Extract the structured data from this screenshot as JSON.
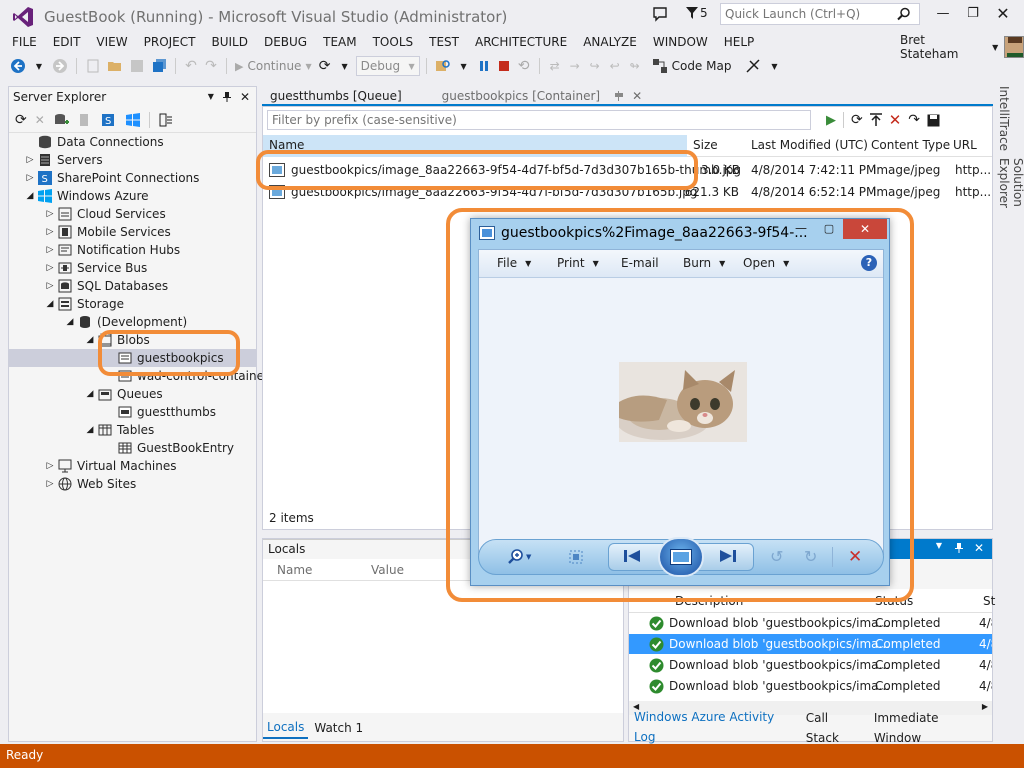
{
  "window": {
    "title": "GuestBook (Running) - Microsoft Visual Studio (Administrator)",
    "notifications_count": "5",
    "quick_launch_placeholder": "Quick Launch (Ctrl+Q)",
    "user_name": "Bret Stateham"
  },
  "menu": [
    "FILE",
    "EDIT",
    "VIEW",
    "PROJECT",
    "BUILD",
    "DEBUG",
    "TEAM",
    "TOOLS",
    "TEST",
    "ARCHITECTURE",
    "ANALYZE",
    "WINDOW",
    "HELP"
  ],
  "toolbar": {
    "continue_label": "Continue",
    "config_value": "Debug",
    "code_map_label": "Code Map"
  },
  "server_explorer": {
    "title": "Server Explorer",
    "tree": [
      {
        "label": "Data Connections",
        "icon": "database-icon",
        "depth": 0,
        "exp": ""
      },
      {
        "label": "Servers",
        "icon": "server-icon",
        "depth": 0,
        "exp": "collapsed"
      },
      {
        "label": "SharePoint Connections",
        "icon": "sharepoint-icon",
        "depth": 0,
        "exp": "collapsed"
      },
      {
        "label": "Windows Azure",
        "icon": "windows-icon",
        "depth": 0,
        "exp": "expanded"
      },
      {
        "label": "Cloud Services",
        "icon": "cloud-icon",
        "depth": 1,
        "exp": "collapsed"
      },
      {
        "label": "Mobile Services",
        "icon": "mobile-icon",
        "depth": 1,
        "exp": "collapsed"
      },
      {
        "label": "Notification Hubs",
        "icon": "hub-icon",
        "depth": 1,
        "exp": "collapsed"
      },
      {
        "label": "Service Bus",
        "icon": "bus-icon",
        "depth": 1,
        "exp": "collapsed"
      },
      {
        "label": "SQL Databases",
        "icon": "sql-icon",
        "depth": 1,
        "exp": "collapsed"
      },
      {
        "label": "Storage",
        "icon": "storage-icon",
        "depth": 1,
        "exp": "expanded"
      },
      {
        "label": "(Development)",
        "icon": "storage-account-icon",
        "depth": 2,
        "exp": "expanded"
      },
      {
        "label": "Blobs",
        "icon": "blob-folder-icon",
        "depth": 3,
        "exp": "expanded"
      },
      {
        "label": "guestbookpics",
        "icon": "container-icon",
        "depth": 4,
        "exp": "",
        "selected": true
      },
      {
        "label": "wad-control-container",
        "icon": "container-icon",
        "depth": 4,
        "exp": ""
      },
      {
        "label": "Queues",
        "icon": "queue-folder-icon",
        "depth": 3,
        "exp": "expanded"
      },
      {
        "label": "guestthumbs",
        "icon": "queue-icon",
        "depth": 4,
        "exp": ""
      },
      {
        "label": "Tables",
        "icon": "table-folder-icon",
        "depth": 3,
        "exp": "expanded"
      },
      {
        "label": "GuestBookEntry",
        "icon": "table-icon",
        "depth": 4,
        "exp": ""
      },
      {
        "label": "Virtual Machines",
        "icon": "vm-icon",
        "depth": 1,
        "exp": "collapsed"
      },
      {
        "label": "Web Sites",
        "icon": "globe-icon",
        "depth": 1,
        "exp": "collapsed"
      }
    ]
  },
  "doc_tabs": {
    "queue_tab": "guestthumbs [Queue]",
    "container_tab": "guestbookpics [Container]"
  },
  "blob_view": {
    "filter_placeholder": "Filter by prefix (case-sensitive)",
    "columns": [
      "Name",
      "Size",
      "Last Modified (UTC)",
      "Content Type",
      "URL"
    ],
    "rows": [
      {
        "name": "guestbookpics/image_8aa22663-9f54-4d7f-bf5d-7d3d307b165b-thumb.jpg",
        "size": "3.0 KB",
        "modified": "4/8/2014 7:42:11 PM",
        "type": "image/jpeg",
        "url": "http..."
      },
      {
        "name": "guestbookpics/image_8aa22663-9f54-4d7f-bf5d-7d3d307b165b.jpg",
        "size": "621.3 KB",
        "modified": "4/8/2014 6:52:14 PM",
        "type": "image/jpeg",
        "url": "http..."
      }
    ],
    "count": "2 items"
  },
  "locals": {
    "title": "Locals",
    "columns": [
      "Name",
      "Value"
    ]
  },
  "bottom_tabs_left": [
    "Locals",
    "Watch 1"
  ],
  "activity_log": {
    "columns": [
      "Description",
      "Status",
      "St"
    ],
    "rows": [
      {
        "desc": "Download blob 'guestbookpics/ima...",
        "status": "Completed",
        "st": "4/8"
      },
      {
        "desc": "Download blob 'guestbookpics/ima...",
        "status": "Completed",
        "st": "4/8"
      },
      {
        "desc": "Download blob 'guestbookpics/ima...",
        "status": "Completed",
        "st": "4/8"
      },
      {
        "desc": "Download blob 'guestbookpics/ima...",
        "status": "Completed",
        "st": "4/8"
      }
    ]
  },
  "bottom_tabs_right": [
    "Windows Azure Activity Log",
    "Call Stack",
    "Immediate Window"
  ],
  "side_tabs": [
    "IntelliTrace",
    "Solution Explorer"
  ],
  "viewer": {
    "title": "guestbookpics%2Fimage_8aa22663-9f54-...",
    "menu": [
      "File",
      "Print",
      "E-mail",
      "Burn",
      "Open"
    ]
  },
  "status": {
    "text": "Ready"
  },
  "colors": {
    "accent": "#007acc",
    "status_bar": "#ca5100",
    "highlight": "#f28c38",
    "selection": "#3399ff"
  }
}
